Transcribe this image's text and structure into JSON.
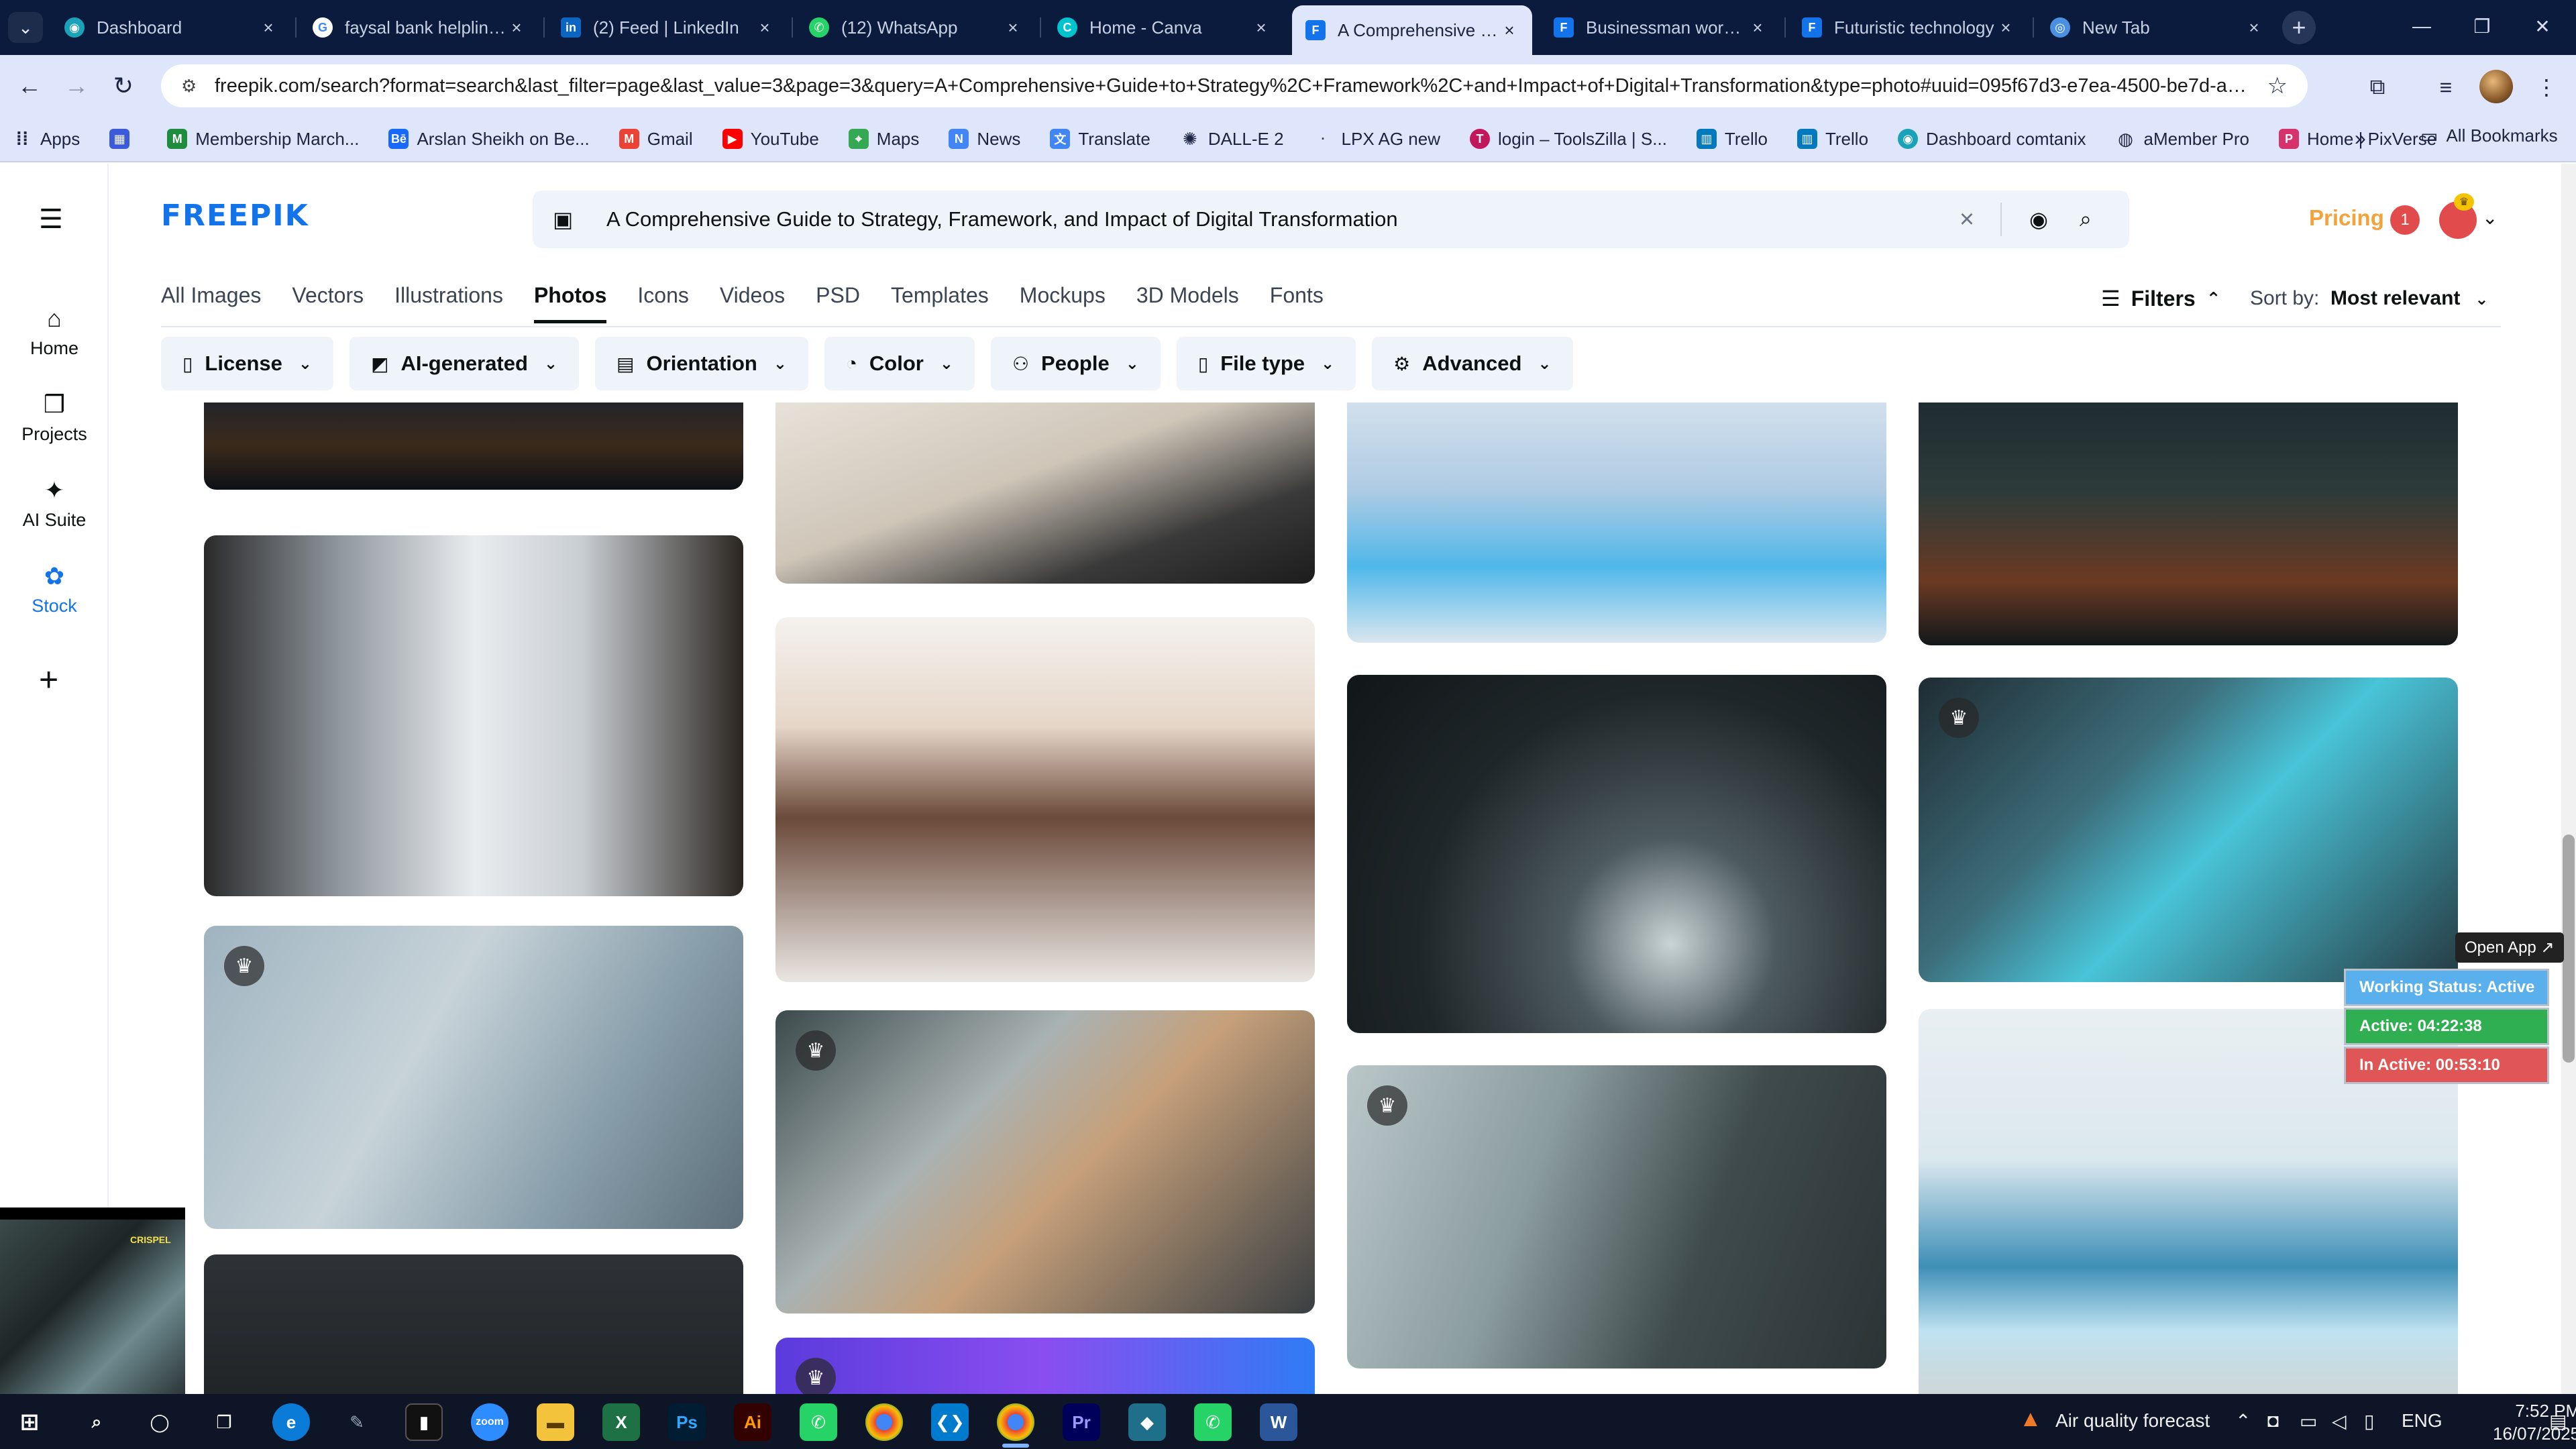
{
  "browser": {
    "tabs": [
      {
        "title": "Dashboard",
        "icon": "dashboard-icon",
        "color": "#1aa3b8"
      },
      {
        "title": "faysal bank helpline -",
        "icon": "google-icon",
        "color": "#ffffff"
      },
      {
        "title": "(2) Feed | LinkedIn",
        "icon": "linkedin-icon",
        "color": "#0a66c2"
      },
      {
        "title": "(12) WhatsApp",
        "icon": "whatsapp-icon",
        "color": "#25d366"
      },
      {
        "title": "Home - Canva",
        "icon": "canva-icon",
        "color": "#00c4cc"
      },
      {
        "title": "A Comprehensive Gu",
        "icon": "freepik-icon",
        "color": "#1273eb"
      },
      {
        "title": "Businessman working",
        "icon": "freepik-icon",
        "color": "#1273eb"
      },
      {
        "title": "Futuristic technology",
        "icon": "freepik-icon",
        "color": "#1273eb"
      },
      {
        "title": "New Tab",
        "icon": "chrome-icon",
        "color": "#4a90e2"
      }
    ],
    "url": "freepik.com/search?format=search&last_filter=page&last_value=3&page=3&query=A+Comprehensive+Guide+to+Strategy%2C+Framework%2C+and+Impact+of+Digital+Transformation&type=photo#uuid=095f67d3-e7ea-4500-be7d-a48bfbc88e..."
  },
  "bookmarks": {
    "items": [
      {
        "label": "Apps",
        "icon": "apps-grid-icon",
        "color": "#1b2440"
      },
      {
        "label": "",
        "icon": "grid-icon",
        "color": "#3b5bdb"
      },
      {
        "label": "Membership March...",
        "icon": "membership-icon",
        "color": "#1e8e3e"
      },
      {
        "label": "Arslan Sheikh on Be...",
        "icon": "behance-icon",
        "color": "#1769ff"
      },
      {
        "label": "Gmail",
        "icon": "gmail-icon",
        "color": "#ea4335"
      },
      {
        "label": "YouTube",
        "icon": "youtube-icon",
        "color": "#ff0000"
      },
      {
        "label": "Maps",
        "icon": "maps-icon",
        "color": "#34a853"
      },
      {
        "label": "News",
        "icon": "news-icon",
        "color": "#4285f4"
      },
      {
        "label": "Translate",
        "icon": "translate-icon",
        "color": "#4285f4"
      },
      {
        "label": "DALL-E 2",
        "icon": "openai-icon",
        "color": "#1b2440"
      },
      {
        "label": "LPX AG new",
        "icon": "lpx-icon",
        "color": "#333333"
      },
      {
        "label": "login – ToolsZilla | S...",
        "icon": "toolszilla-icon",
        "color": "#c2185b"
      },
      {
        "label": "Trello",
        "icon": "trello-icon",
        "color": "#0079bf"
      },
      {
        "label": "Trello",
        "icon": "trello-icon",
        "color": "#0079bf"
      },
      {
        "label": "Dashboard comtanix",
        "icon": "dashboard-icon",
        "color": "#1aa3b8"
      },
      {
        "label": "aMember Pro",
        "icon": "amember-icon",
        "color": "#1b2440"
      },
      {
        "label": "Home | PixVerse",
        "icon": "pixverse-icon",
        "color": "#d6336c"
      }
    ],
    "more": "»",
    "all": "All Bookmarks"
  },
  "rail": {
    "items": [
      {
        "label": "Home",
        "icon": "home-icon"
      },
      {
        "label": "Projects",
        "icon": "projects-icon"
      },
      {
        "label": "AI Suite",
        "icon": "ai-sparkle-icon"
      },
      {
        "label": "Stock",
        "icon": "stock-icon"
      }
    ]
  },
  "header": {
    "logo": "FREEPIK",
    "search_query": "A Comprehensive Guide to Strategy, Framework, and Impact of Digital Transformation",
    "pricing": "Pricing",
    "notifications": "1"
  },
  "type_tabs": [
    "All Images",
    "Vectors",
    "Illustrations",
    "Photos",
    "Icons",
    "Videos",
    "PSD",
    "Templates",
    "Mockups",
    "3D Models",
    "Fonts"
  ],
  "active_type_tab": "Photos",
  "filters_label": "Filters",
  "sort": {
    "label": "Sort by:",
    "value": "Most relevant"
  },
  "filter_chips": [
    {
      "label": "License",
      "icon": "license-icon"
    },
    {
      "label": "AI-generated",
      "icon": "ai-generated-icon"
    },
    {
      "label": "Orientation",
      "icon": "orientation-icon"
    },
    {
      "label": "Color",
      "icon": "palette-icon"
    },
    {
      "label": "People",
      "icon": "people-icon"
    },
    {
      "label": "File type",
      "icon": "file-icon"
    },
    {
      "label": "Advanced",
      "icon": "settings-icon"
    }
  ],
  "results": [
    {
      "subject": "city skyline at night",
      "premium": false
    },
    {
      "subject": "coffee cup and laptop",
      "premium": false
    },
    {
      "subject": "touch screen table with globe",
      "premium": false
    },
    {
      "subject": "businessman touching holographic screen",
      "premium": false
    },
    {
      "subject": "business team at whiteboard",
      "premium": false
    },
    {
      "subject": "woman holding tablet with hexagon diagram",
      "premium": false
    },
    {
      "subject": "businessman with 11:50 holographic interface",
      "premium": false
    },
    {
      "subject": "meeting table with hologram globe",
      "premium": true
    },
    {
      "subject": "team with holographic charts",
      "premium": true
    },
    {
      "subject": "top view team meeting",
      "premium": true
    },
    {
      "subject": "video call with analytics overlay",
      "premium": true
    },
    {
      "subject": "woman presenting dashboard",
      "premium": false
    },
    {
      "subject": "man in VR headset",
      "premium": false
    },
    {
      "subject": "purple digital banner",
      "premium": true
    }
  ],
  "overlay": {
    "open_app": "Open App ↗",
    "working_status": "Working Status: Active",
    "active": "Active: 04:22:38",
    "inactive": "In Active: 00:53:10",
    "webcam_tag": "CRISPEL"
  },
  "taskbar": {
    "weather": "Air quality forecast",
    "lang": "ENG",
    "time": "7:52 PM",
    "date": "16/07/2025",
    "apps": [
      "windows-icon",
      "search-icon",
      "cortana-icon",
      "task-view-icon",
      "edge-icon",
      "pen-icon",
      "terminal-icon",
      "zoom-icon",
      "file-explorer-icon",
      "excel-icon",
      "photoshop-icon",
      "illustrator-icon",
      "whatsapp-icon",
      "chrome-icon",
      "vscode-icon",
      "chrome-icon",
      "premiere-icon",
      "app-icon",
      "whatsapp-icon",
      "word-icon"
    ]
  }
}
